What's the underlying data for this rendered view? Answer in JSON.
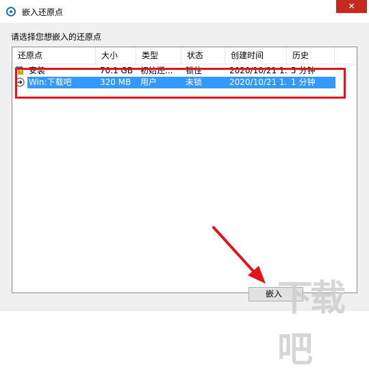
{
  "window": {
    "title": "嵌入还原点",
    "close_label": "✕"
  },
  "prompt": "请选择您想嵌入的还原点",
  "columns": [
    "还原点",
    "大小",
    "类型",
    "状态",
    "创建时间",
    "历史"
  ],
  "rows": [
    {
      "name": "安装",
      "size": "70.1 GB",
      "type": "初始还...",
      "status": "锁住",
      "created": "2020/10/21 1...",
      "history": "5 分钟"
    },
    {
      "name": "Win:下载吧",
      "size": "320 MB",
      "type": "用户",
      "status": "未锁",
      "created": "2020/10/21 1...",
      "history": "1 分钟"
    }
  ],
  "embed_button": "嵌入",
  "watermark": "下载吧",
  "colors": {
    "selection": "#3399ff",
    "annotation": "#e0141a",
    "close": "#c42b1c"
  }
}
